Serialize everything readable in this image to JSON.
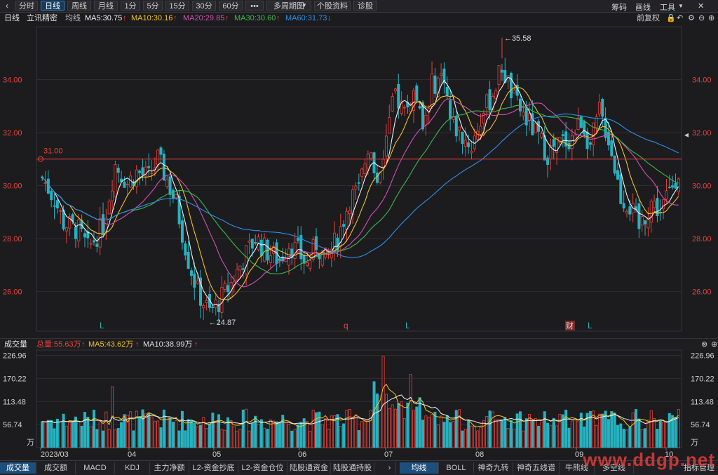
{
  "toolbar": {
    "back_icon": "chevron-left-icon",
    "tabs": [
      {
        "label": "分时",
        "active": false
      },
      {
        "label": "日线",
        "active": true
      },
      {
        "label": "周线",
        "active": false
      },
      {
        "label": "月线",
        "active": false
      },
      {
        "label": "1分",
        "active": false
      },
      {
        "label": "5分",
        "active": false
      },
      {
        "label": "15分",
        "active": false
      },
      {
        "label": "30分",
        "active": false
      },
      {
        "label": "60分",
        "active": false
      },
      {
        "label": "•••",
        "active": false
      },
      {
        "label": "多周期图",
        "active": false
      },
      {
        "label": "个股资料",
        "active": false
      },
      {
        "label": "诊股",
        "active": false
      }
    ],
    "right": {
      "chips": "筹码",
      "draw": "画线",
      "tools": "工具"
    }
  },
  "ma_bar": {
    "period": "日线",
    "stock_name": "立讯精密",
    "ma_label": "均线",
    "ma5": "MA5:30.75",
    "ma10": "MA10:30.16",
    "ma20": "MA20:29.85",
    "ma30": "MA30:30.60",
    "ma60": "MA60:31.73",
    "restore": "前复权"
  },
  "colors": {
    "up": "#e8403a",
    "down": "#27b2c0",
    "ma5": "#f0f0f0",
    "ma10": "#f2c21e",
    "ma20": "#d44fb1",
    "ma30": "#3cb94c",
    "ma60": "#2f8fe8"
  },
  "price_axis": {
    "ticks": [
      "34.00",
      "32.00",
      "30.00",
      "28.00",
      "26.00"
    ]
  },
  "annotations": {
    "high": "35.58",
    "low": "24.87",
    "ref_line": "31.00",
    "finance": "财"
  },
  "volume_bar": {
    "label": "成交量",
    "total": "总量:55.63万",
    "ma5": "MA5:43.62万",
    "ma10": "MA10:38.99万"
  },
  "volume_axis": {
    "ticks": [
      "226.96",
      "170.22",
      "113.48",
      "56.74"
    ],
    "unit": "万"
  },
  "time_axis": {
    "labels": [
      "2023/03",
      "04",
      "05",
      "06",
      "07",
      "08",
      "09",
      "10"
    ]
  },
  "bottom_tabs": {
    "left": [
      "成交量",
      "成交额",
      "MACD",
      "KDJ",
      "主力净额",
      "L2-资金抄底",
      "L2-资金仓位",
      "陆股通资金",
      "陆股通持股"
    ],
    "right": [
      "均线",
      "BOLL",
      "神奇九转",
      "神奇五线谱",
      "牛熊线",
      "多空线"
    ],
    "manage": "指标管理"
  },
  "watermark": "www.ddgp.net",
  "chart_data": {
    "type": "candlestick",
    "title": "立讯精密 日线",
    "ylim": [
      24.5,
      36.0
    ],
    "volume_ylim": [
      0,
      240
    ],
    "x_months": [
      "2023/03",
      "04",
      "05",
      "06",
      "07",
      "08",
      "09",
      "10"
    ],
    "anchors": [
      [
        0,
        30.3
      ],
      [
        4,
        29.5
      ],
      [
        7,
        28.6
      ],
      [
        12,
        28.3
      ],
      [
        15,
        27.6
      ],
      [
        20,
        28.5
      ],
      [
        24,
        30.8
      ],
      [
        28,
        30.1
      ],
      [
        31,
        30.5
      ],
      [
        35,
        30.3
      ],
      [
        38,
        31.0
      ],
      [
        41,
        30.2
      ],
      [
        44,
        29.3
      ],
      [
        48,
        27.2
      ],
      [
        51,
        26.0
      ],
      [
        55,
        25.2
      ],
      [
        58,
        25.6
      ],
      [
        62,
        26.3
      ],
      [
        66,
        27.2
      ],
      [
        70,
        28.0
      ],
      [
        74,
        27.5
      ],
      [
        78,
        27.2
      ],
      [
        81,
        27.8
      ],
      [
        84,
        27.5
      ],
      [
        87,
        27.0
      ],
      [
        90,
        27.8
      ],
      [
        93,
        27.2
      ],
      [
        97,
        28.0
      ],
      [
        101,
        29.5
      ],
      [
        104,
        29.8
      ],
      [
        107,
        31.5
      ],
      [
        110,
        30.2
      ],
      [
        113,
        31.8
      ],
      [
        116,
        33.5
      ],
      [
        119,
        32.8
      ],
      [
        122,
        33.5
      ],
      [
        125,
        32.2
      ],
      [
        128,
        33.8
      ],
      [
        132,
        34.2
      ],
      [
        134,
        32.5
      ],
      [
        137,
        32.0
      ],
      [
        141,
        31.5
      ],
      [
        144,
        32.5
      ],
      [
        148,
        33.5
      ],
      [
        151,
        34.5
      ],
      [
        155,
        33.2
      ],
      [
        159,
        32.5
      ],
      [
        163,
        31.8
      ],
      [
        166,
        31.2
      ],
      [
        170,
        31.6
      ],
      [
        174,
        31.8
      ],
      [
        177,
        32.5
      ],
      [
        180,
        31.5
      ],
      [
        183,
        32.8
      ],
      [
        186,
        31.8
      ],
      [
        190,
        29.6
      ],
      [
        193,
        29.2
      ],
      [
        196,
        28.4
      ],
      [
        200,
        29.4
      ],
      [
        203,
        29.0
      ],
      [
        206,
        29.8
      ],
      [
        209,
        30.6
      ]
    ],
    "ma_last": {
      "MA5": 30.75,
      "MA10": 30.16,
      "MA20": 29.85,
      "MA30": 30.6,
      "MA60": 31.73
    },
    "high": 35.58,
    "low": 24.87,
    "volume_last": 55.63
  }
}
